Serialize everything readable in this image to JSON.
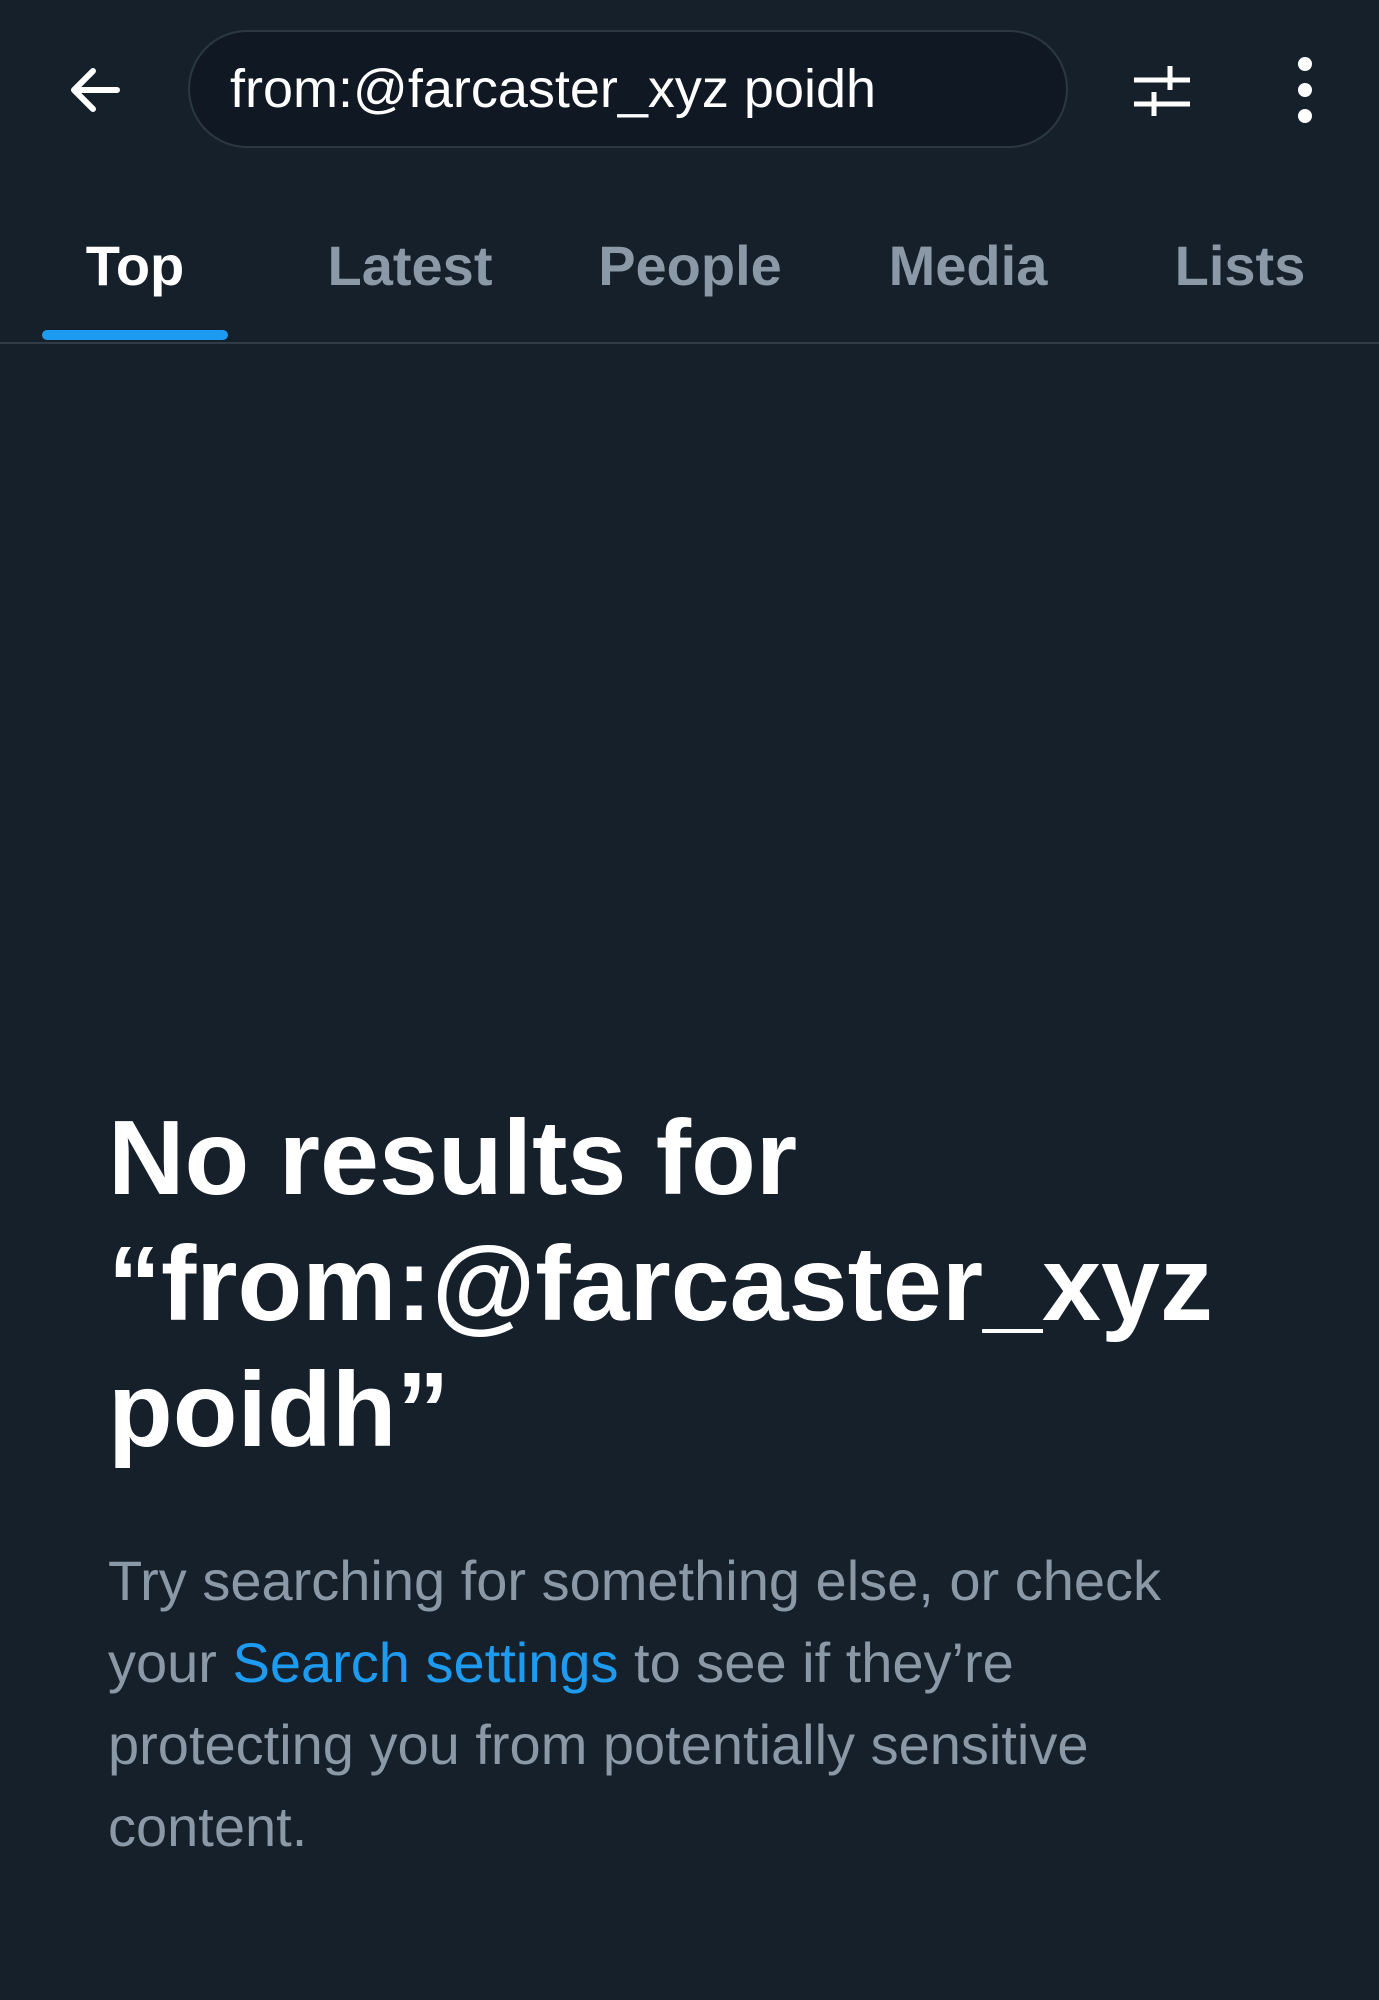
{
  "header": {
    "back_icon": "arrow-left-icon",
    "search_query": "from:@farcaster_xyz poidh",
    "filter_icon": "sliders-icon",
    "more_icon": "more-vertical-icon"
  },
  "tabs": [
    {
      "label": "Top",
      "active": true
    },
    {
      "label": "Latest",
      "active": false
    },
    {
      "label": "People",
      "active": false
    },
    {
      "label": "Media",
      "active": false
    },
    {
      "label": "Lists",
      "active": false
    }
  ],
  "empty_state": {
    "title_line1": "No results for",
    "title_line2": "“from:@farcaster_xyz",
    "title_line3": "poidh”",
    "message_before_link": "Try searching for something else, or check your ",
    "link_text": "Search settings",
    "message_after_link": " to see if they’re protecting you from potentially sensitive content."
  },
  "colors": {
    "background": "#15202b",
    "accent": "#1d9bf0",
    "muted_text": "#8b98a5",
    "primary_text": "#ffffff"
  }
}
